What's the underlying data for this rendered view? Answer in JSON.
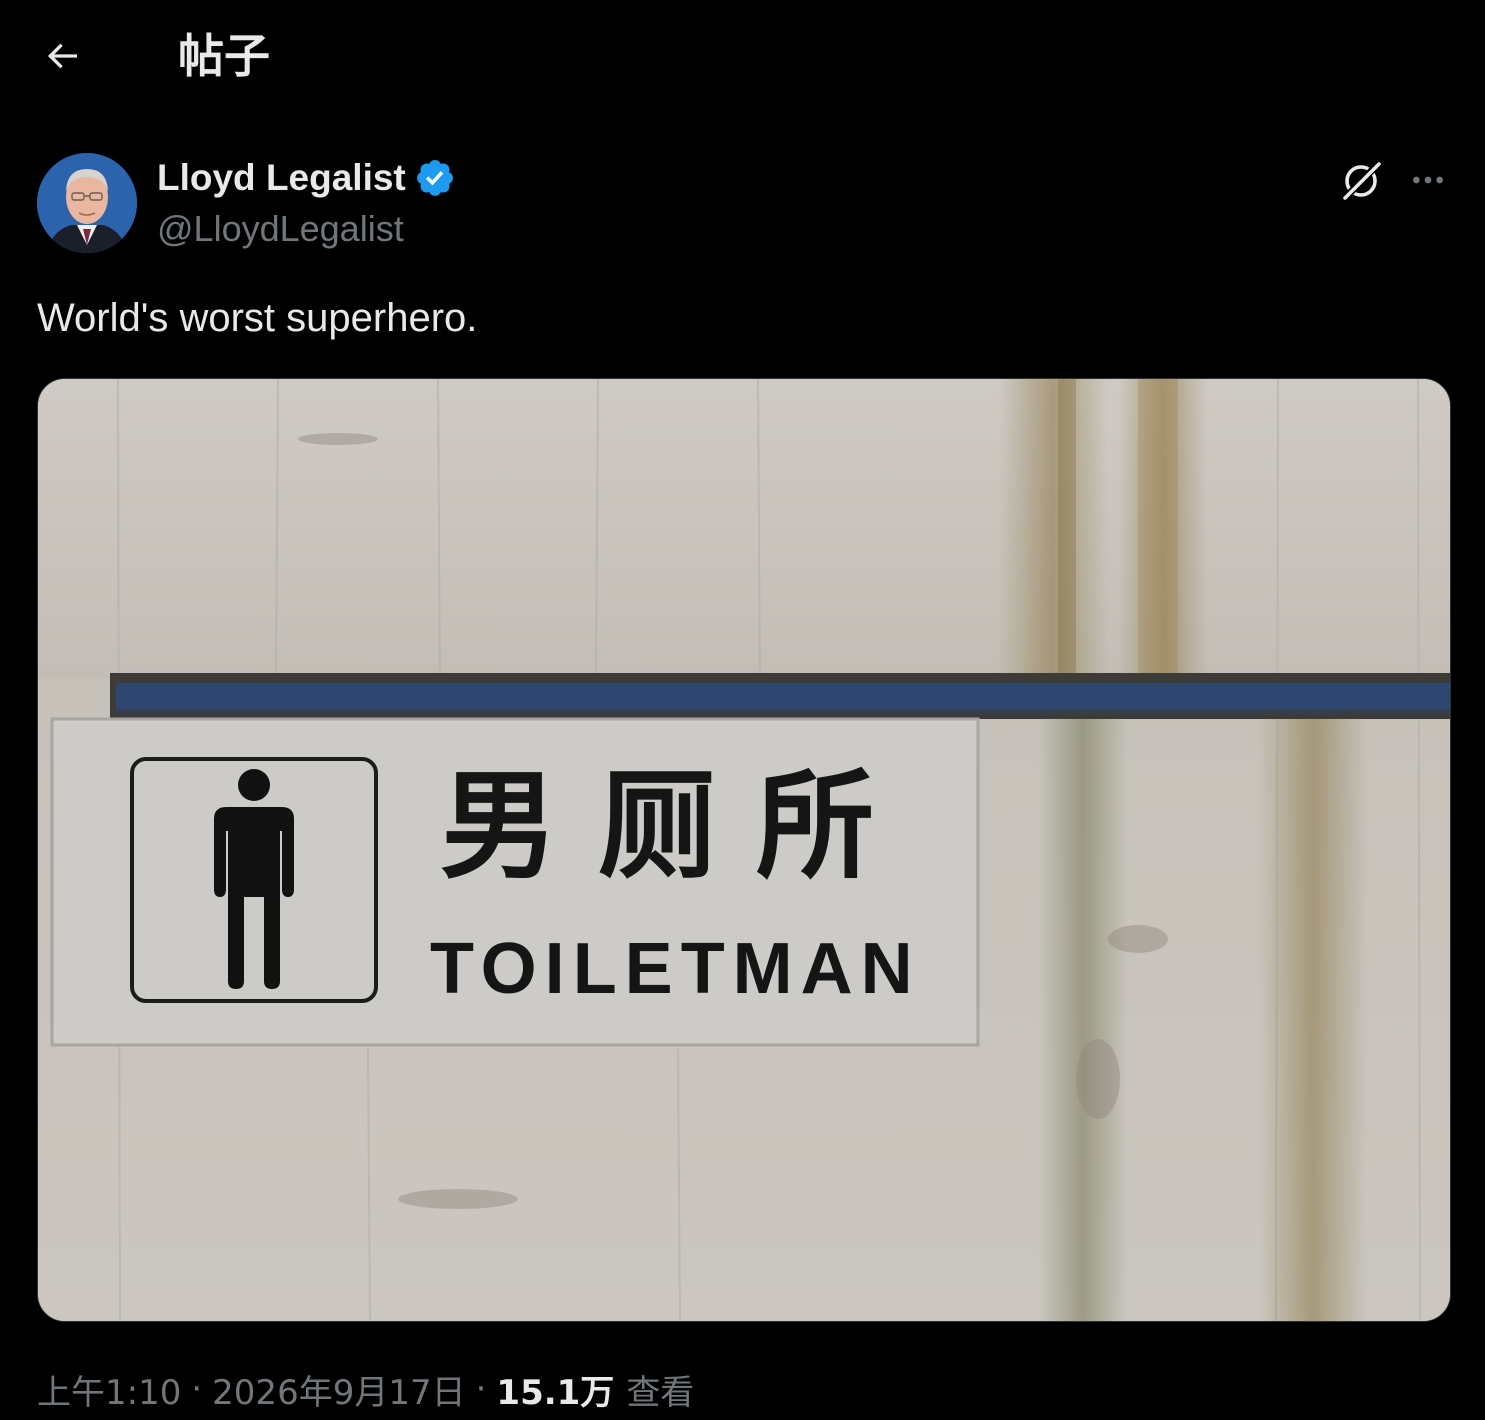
{
  "header": {
    "title": "帖子",
    "back_icon": "arrow-left-icon"
  },
  "author": {
    "display_name": "Lloyd Legalist",
    "handle": "@LloydLegalist",
    "verified": true,
    "verified_color": "#1d9bf0"
  },
  "actions": {
    "grok_icon": "grok-icon",
    "more_icon": "more-horizontal-icon"
  },
  "tweet": {
    "text": "World's worst superhero."
  },
  "media": {
    "sign_chinese": "男厕所",
    "sign_english": "TOILETMAN"
  },
  "meta": {
    "time": "上午1:10",
    "separator": "·",
    "date": "2026年9月17日",
    "views_count": "15.1万",
    "views_label": "查看"
  },
  "colors": {
    "background": "#000000",
    "text_primary": "#e7e9ea",
    "text_secondary": "#71767b",
    "accent": "#1d9bf0"
  }
}
